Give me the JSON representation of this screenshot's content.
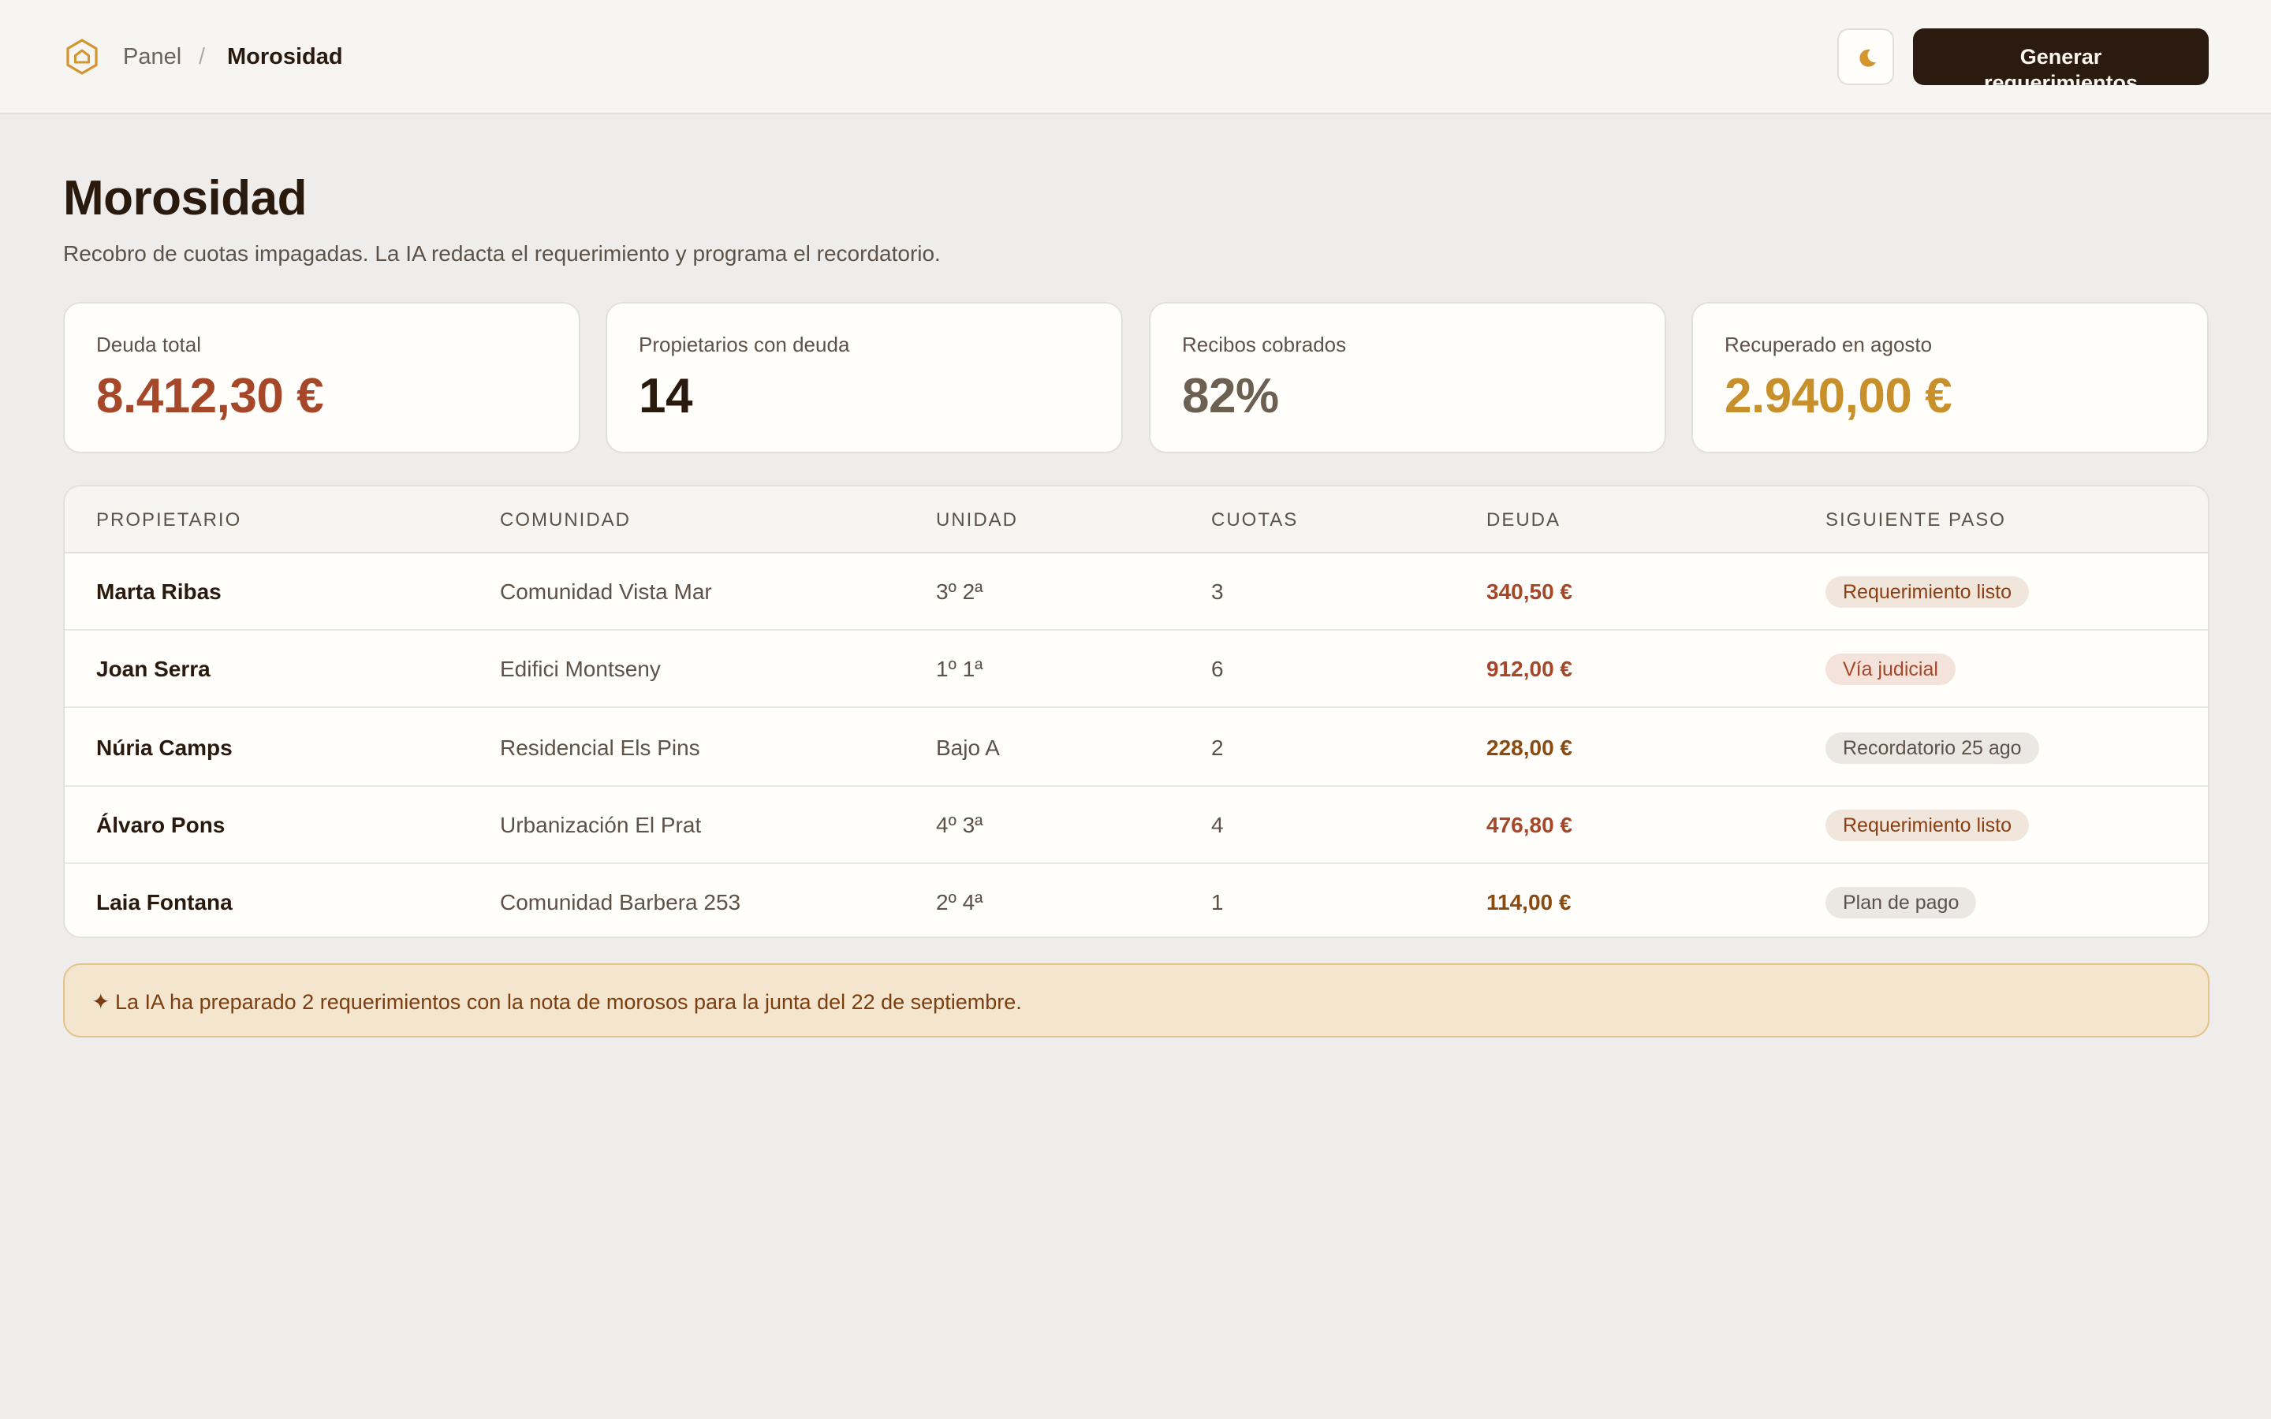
{
  "header": {
    "brand_icon": "house-hexagon-icon",
    "breadcrumb_root": "Panel",
    "breadcrumb_separator": "/",
    "breadcrumb_current": "Morosidad",
    "theme_toggle_icon": "moon-icon",
    "primary_button_label": "Generar requerimientos"
  },
  "page": {
    "title": "Morosidad",
    "subtitle": "Recobro de cuotas impagadas. La IA redacta el requerimiento y programa el recordatorio."
  },
  "stats": [
    {
      "label": "Deuda total",
      "value": "8.412,30 €",
      "color": "#a6472a"
    },
    {
      "label": "Propietarios con deuda",
      "value": "14",
      "color": "#2a1a0e"
    },
    {
      "label": "Recibos cobrados",
      "value": "82%",
      "color": "#6b6052"
    },
    {
      "label": "Recuperado en agosto",
      "value": "2.940,00 €",
      "color": "#c8902a"
    }
  ],
  "table": {
    "columns": [
      "PROPIETARIO",
      "COMUNIDAD",
      "UNIDAD",
      "CUOTAS",
      "DEUDA",
      "SIGUIENTE PASO"
    ],
    "rows": [
      {
        "owner": "Marta Ribas",
        "community": "Comunidad Vista Mar",
        "unit": "3º 2ª",
        "quotas": "3",
        "debt": "340,50 €",
        "debt_color": "#a6472a",
        "status": "Requerimiento listo",
        "status_bg": "#f1e6dc",
        "status_color": "#8a3f14"
      },
      {
        "owner": "Joan Serra",
        "community": "Edifici Montseny",
        "unit": "1º 1ª",
        "quotas": "6",
        "debt": "912,00 €",
        "debt_color": "#a6472a",
        "status": "Vía judicial",
        "status_bg": "#f3e3db",
        "status_color": "#a6472a"
      },
      {
        "owner": "Núria Camps",
        "community": "Residencial Els Pins",
        "unit": "Bajo A",
        "quotas": "2",
        "debt": "228,00 €",
        "debt_color": "#8a4a10",
        "status": "Recordatorio 25 ago",
        "status_bg": "#ebe8e3",
        "status_color": "#5e5248"
      },
      {
        "owner": "Álvaro Pons",
        "community": "Urbanización El Prat",
        "unit": "4º 3ª",
        "quotas": "4",
        "debt": "476,80 €",
        "debt_color": "#a6472a",
        "status": "Requerimiento listo",
        "status_bg": "#f1e6dc",
        "status_color": "#8a3f14"
      },
      {
        "owner": "Laia Fontana",
        "community": "Comunidad Barbera 253",
        "unit": "2º 4ª",
        "quotas": "1",
        "debt": "114,00 €",
        "debt_color": "#8a4a10",
        "status": "Plan de pago",
        "status_bg": "#ebe8e3",
        "status_color": "#5e5248"
      }
    ]
  },
  "notice": {
    "icon": "sparkle-icon",
    "glyph": "✦",
    "text": "La IA ha preparado 2 requerimientos con la nota de morosos para la junta del 22 de septiembre."
  }
}
